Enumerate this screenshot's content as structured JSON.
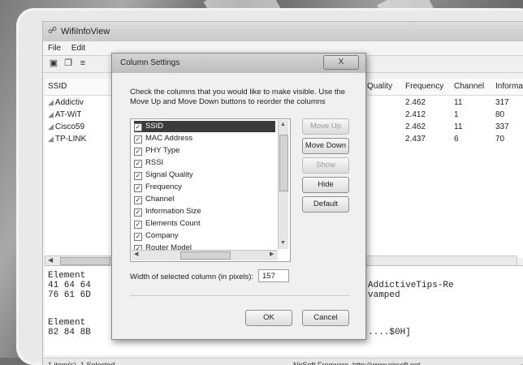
{
  "window": {
    "title": "WifiInfoView",
    "menu": [
      "File",
      "Edit"
    ],
    "columns": [
      "SSID",
      "l Quality",
      "Frequency",
      "Channel",
      "Informati"
    ],
    "rows": [
      {
        "ssid": "Addictiv",
        "frequency": "2.462",
        "channel": "11",
        "info": "317"
      },
      {
        "ssid": "AT-WiT",
        "frequency": "2.412",
        "channel": "1",
        "info": "80"
      },
      {
        "ssid": "Cisco59",
        "frequency": "2.462",
        "channel": "11",
        "info": "337"
      },
      {
        "ssid": "TP-LINK",
        "frequency": "2.437",
        "channel": "6",
        "info": "70"
      }
    ],
    "detail": {
      "line1": "Element",
      "line2": "41 64 64",
      "line3": "76 61 6D",
      "line4": "Element",
      "line5": "82 84 8B",
      "right1": "AddictiveTips-Re",
      "right2": "vamped",
      "right3": "....$0H]"
    },
    "status_left": "1 item(s), 1 Selected",
    "status_right": "NirSoft Freeware.  http://www.nirsoft.net"
  },
  "dialog": {
    "title": "Column Settings",
    "close_label": "X",
    "instructions": "Check the columns that you would like to make visible. Use the Move Up and Move Down buttons to reorder the columns",
    "items": [
      {
        "label": "SSID",
        "checked": true,
        "selected": true
      },
      {
        "label": "MAC Address",
        "checked": true,
        "selected": false
      },
      {
        "label": "PHY Type",
        "checked": true,
        "selected": false
      },
      {
        "label": "RSSI",
        "checked": true,
        "selected": false
      },
      {
        "label": "Signal Quality",
        "checked": true,
        "selected": false
      },
      {
        "label": "Frequency",
        "checked": true,
        "selected": false
      },
      {
        "label": "Channel",
        "checked": true,
        "selected": false
      },
      {
        "label": "Information Size",
        "checked": true,
        "selected": false
      },
      {
        "label": "Elements Count",
        "checked": true,
        "selected": false
      },
      {
        "label": "Company",
        "checked": true,
        "selected": false
      },
      {
        "label": "Router Model",
        "checked": true,
        "selected": false
      }
    ],
    "move_up": "Move Up",
    "move_down": "Move Down",
    "show": "Show",
    "hide": "Hide",
    "default": "Default",
    "width_label": "Width of selected column (in pixels):",
    "width_value": "157",
    "ok": "OK",
    "cancel": "Cancel"
  }
}
